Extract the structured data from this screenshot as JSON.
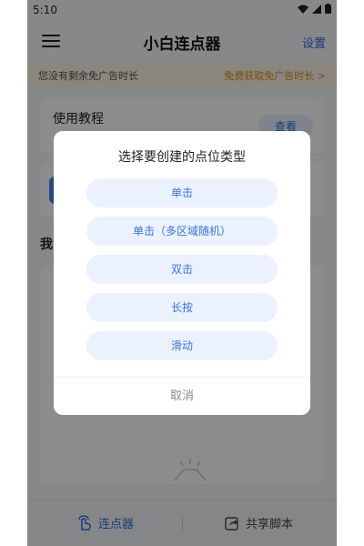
{
  "status_bar": {
    "time": "5:10"
  },
  "header": {
    "title": "小白连点器",
    "settings_label": "设置"
  },
  "notice": {
    "left_text": "您没有剩余免广告时长",
    "right_text": "免费获取免广告时长 >"
  },
  "tutorial": {
    "title": "使用教程",
    "view_label": "查看"
  },
  "section": {
    "title": "我"
  },
  "bottom_nav": {
    "clicker_label": "连点器",
    "share_label": "共享脚本"
  },
  "dialog": {
    "title": "选择要创建的点位类型",
    "options": [
      "单击",
      "单击（多区域随机）",
      "双击",
      "长按",
      "滑动"
    ],
    "cancel_label": "取消"
  },
  "colors": {
    "accent": "#2f6fe0",
    "notice_accent": "#e08a1a",
    "option_bg": "#ebf1fd"
  }
}
